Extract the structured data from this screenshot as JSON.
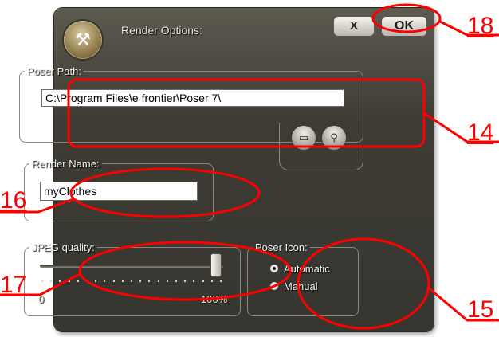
{
  "window": {
    "title": "Render Options:",
    "close_label": "X",
    "ok_label": "OK"
  },
  "poser_path": {
    "legend": "Poser Path:",
    "value": "C:\\Program Files\\e frontier\\Poser 7\\",
    "browse_icon": "folder-icon",
    "search_icon": "magnifier-icon"
  },
  "render_name": {
    "legend": "Render Name:",
    "value": "myClothes"
  },
  "jpeg_quality": {
    "legend": "JPEG quality:",
    "min_label": "0",
    "max_label": "100%",
    "value_percent": 100,
    "tick_count": 21
  },
  "poser_icon": {
    "legend": "Poser Icon:",
    "options": [
      {
        "label": "Automatic",
        "selected": true
      },
      {
        "label": "Manual",
        "selected": false
      }
    ]
  },
  "annotations": {
    "close_button_number": "18",
    "path_number": "14",
    "name_number": "16",
    "quality_number": "17",
    "icon_number": "15",
    "color": "#ff0000"
  }
}
